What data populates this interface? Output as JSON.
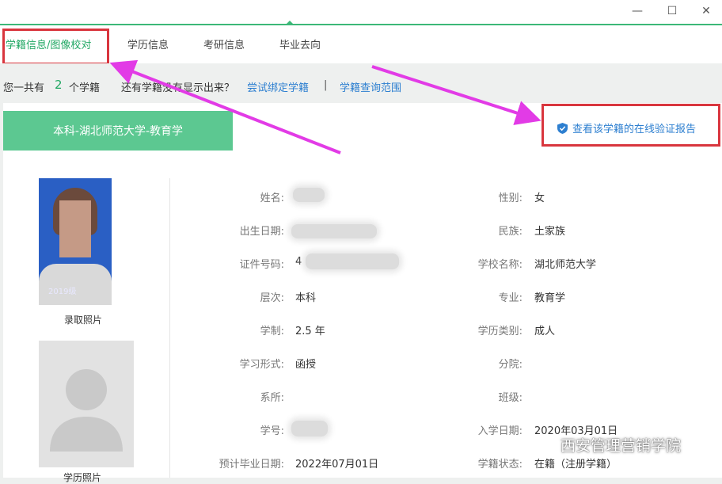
{
  "window": {
    "minimize_glyph": "—",
    "maximize_glyph": "☐",
    "close_glyph": "✕"
  },
  "tabs": [
    {
      "label": "学籍信息/图像校对",
      "active": true
    },
    {
      "label": "学历信息",
      "active": false
    },
    {
      "label": "考研信息",
      "active": false
    },
    {
      "label": "毕业去向",
      "active": false
    }
  ],
  "summary": {
    "prefix": "您一共有",
    "count": "2",
    "suffix": "个学籍",
    "question": "还有学籍没有显示出来？",
    "bind_link": "尝试绑定学籍",
    "separator": "|",
    "scope_link": "学籍查询范围"
  },
  "record": {
    "tab_label": "本科-湖北师范大学-教育学",
    "verify_link": "查看该学籍的在线验证报告",
    "photo_stamp": "2019级",
    "enroll_photo_caption": "录取照片",
    "grad_photo_caption": "学历照片"
  },
  "fields_left": [
    {
      "label": "姓名:",
      "value": ""
    },
    {
      "label": "出生日期:",
      "value": ""
    },
    {
      "label": "证件号码:",
      "value": "4"
    },
    {
      "label": "层次:",
      "value": "本科"
    },
    {
      "label": "学制:",
      "value": "2.5 年"
    },
    {
      "label": "学习形式:",
      "value": "函授"
    },
    {
      "label": "系所:",
      "value": ""
    },
    {
      "label": "学号:",
      "value": ""
    },
    {
      "label": "预计毕业日期:",
      "value": "2022年07月01日"
    }
  ],
  "fields_right": [
    {
      "label": "性别:",
      "value": "女"
    },
    {
      "label": "民族:",
      "value": "土家族"
    },
    {
      "label": "学校名称:",
      "value": "湖北师范大学"
    },
    {
      "label": "专业:",
      "value": "教育学"
    },
    {
      "label": "学历类别:",
      "value": "成人"
    },
    {
      "label": "分院:",
      "value": ""
    },
    {
      "label": "班级:",
      "value": ""
    },
    {
      "label": "入学日期:",
      "value": "2020年03月01日"
    },
    {
      "label": "学籍状态:",
      "value": "在籍（注册学籍）"
    }
  ],
  "watermark": "西安管理营销学院",
  "colors": {
    "accent": "#22a864",
    "tab_bg": "#5cc891",
    "link": "#2d7fd0",
    "annotation_red": "#d9363e",
    "annotation_arrow": "#e23be6"
  }
}
